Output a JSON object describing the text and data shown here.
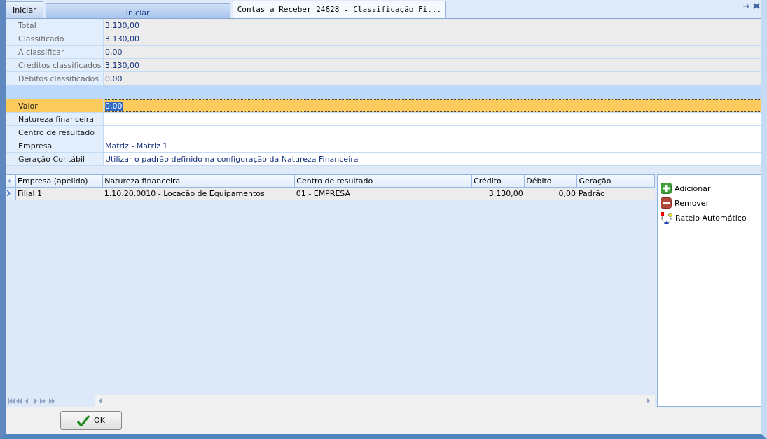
{
  "app_button": {
    "label": "Iniciar"
  },
  "tabs": [
    {
      "label": "Iniciar",
      "selected": false
    },
    {
      "label": "Contas a Receber 24628 - Classificação Fi...",
      "selected": true
    }
  ],
  "summary": [
    {
      "label": "Total",
      "value": "3.130,00"
    },
    {
      "label": "Classificado",
      "value": "3.130,00"
    },
    {
      "label": "À classificar",
      "value": "0,00"
    },
    {
      "label": "Créditos classificados",
      "value": "3.130,00"
    },
    {
      "label": "Débitos classificados",
      "value": "0,00"
    }
  ],
  "form": [
    {
      "label": "Valor",
      "value": "0,00",
      "focused": true
    },
    {
      "label": "Natureza financeira",
      "focused": false
    },
    {
      "label": "Centro de resultado",
      "focused": false
    },
    {
      "label": "Empresa",
      "value": "Matriz - Matriz 1",
      "focused": false
    },
    {
      "label": "Geração Contábil",
      "value": "Utilizar o padrão definido na configuração da Natureza Financeira",
      "focused": false
    }
  ],
  "table": {
    "columns": [
      {
        "label": "Empresa (apelido)",
        "kind": "text"
      },
      {
        "label": "Natureza financeira",
        "kind": "text"
      },
      {
        "label": "Centro de resultado",
        "kind": "text"
      },
      {
        "label": "Crédito",
        "kind": "amount"
      },
      {
        "label": "Débito",
        "kind": "amount"
      },
      {
        "label": "Geração",
        "kind": "text"
      }
    ],
    "rows": [
      {
        "selected": true,
        "cells": [
          "Filial 1",
          "1.10.20.0010 - Locação de Equipamentos",
          "01 - EMPRESA",
          "3.130,00",
          "0,00",
          "Padrão"
        ]
      }
    ]
  },
  "actions": [
    {
      "label": "Adicionar",
      "kind": "add"
    },
    {
      "label": "Remover",
      "kind": "remove"
    },
    {
      "label": "Rateio Automático",
      "kind": "split"
    }
  ],
  "ok_button": {
    "label": "OK"
  }
}
